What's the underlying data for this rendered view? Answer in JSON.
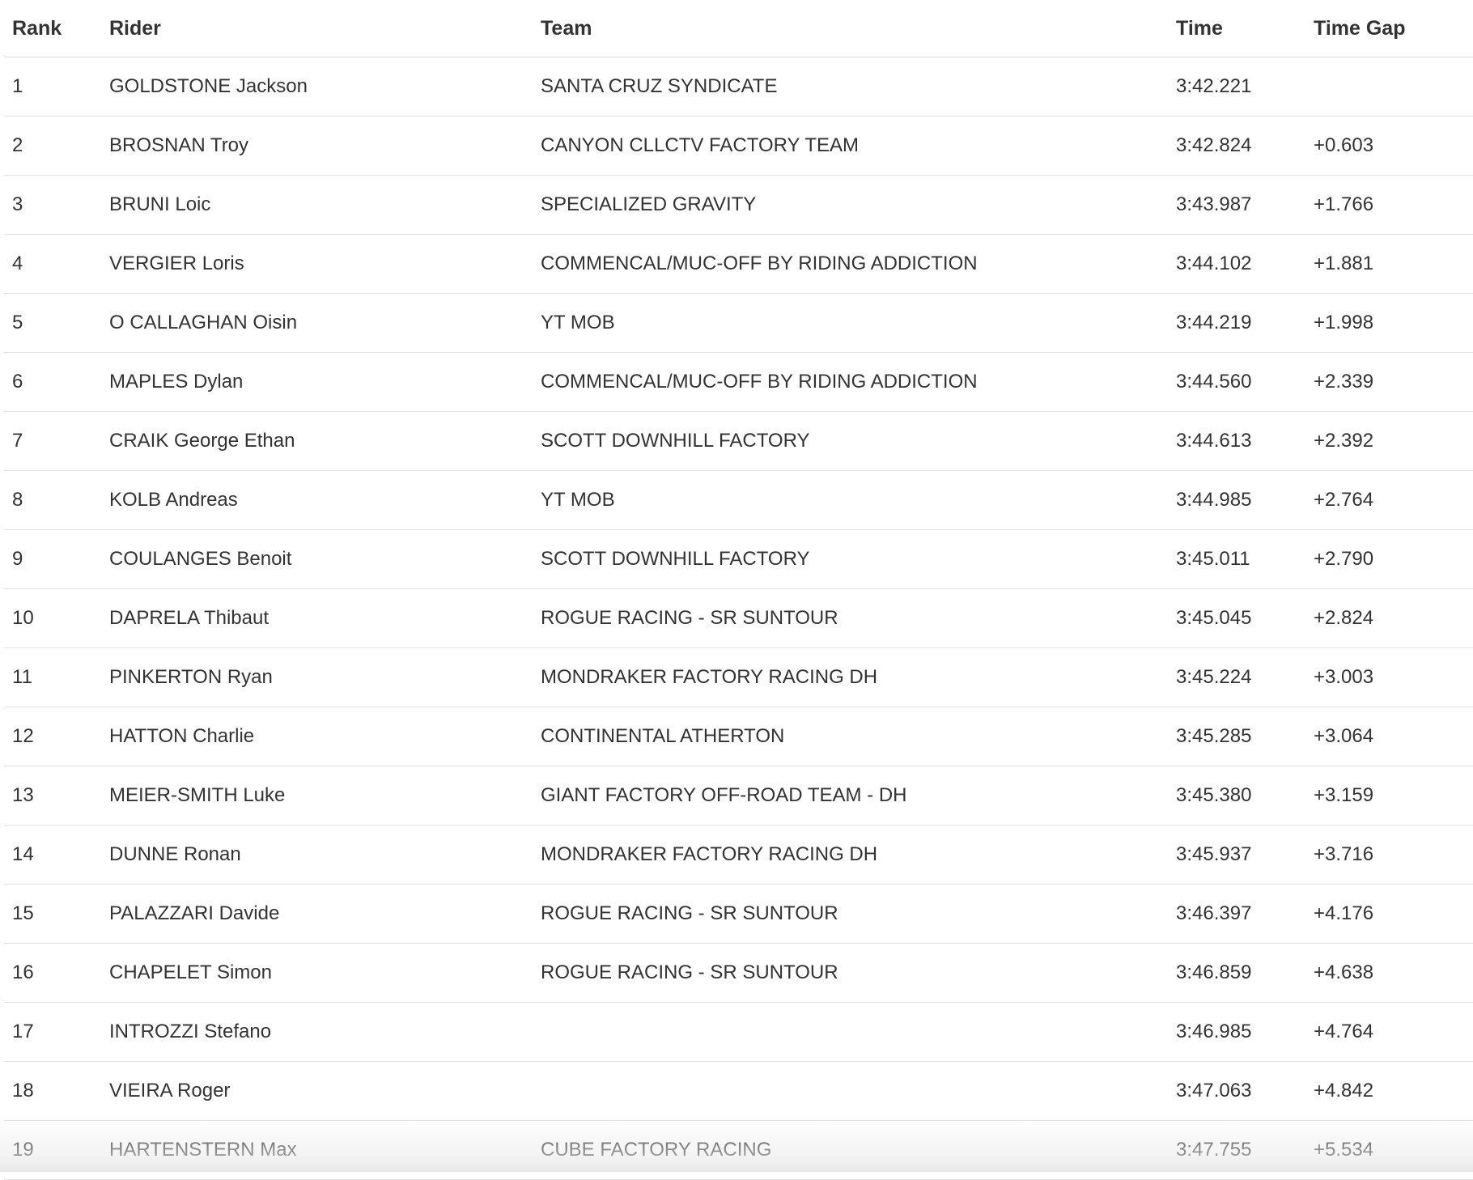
{
  "table": {
    "headers": {
      "rank": "Rank",
      "rider": "Rider",
      "team": "Team",
      "time": "Time",
      "gap": "Time Gap"
    },
    "rows": [
      {
        "rank": "1",
        "rider": "GOLDSTONE Jackson",
        "team": "SANTA CRUZ SYNDICATE",
        "time": "3:42.221",
        "gap": ""
      },
      {
        "rank": "2",
        "rider": "BROSNAN Troy",
        "team": "CANYON CLLCTV FACTORY TEAM",
        "time": "3:42.824",
        "gap": "+0.603"
      },
      {
        "rank": "3",
        "rider": "BRUNI Loic",
        "team": "SPECIALIZED GRAVITY",
        "time": "3:43.987",
        "gap": "+1.766"
      },
      {
        "rank": "4",
        "rider": "VERGIER Loris",
        "team": "COMMENCAL/MUC-OFF BY RIDING ADDICTION",
        "time": "3:44.102",
        "gap": "+1.881"
      },
      {
        "rank": "5",
        "rider": "O CALLAGHAN Oisin",
        "team": "YT MOB",
        "time": "3:44.219",
        "gap": "+1.998"
      },
      {
        "rank": "6",
        "rider": "MAPLES Dylan",
        "team": "COMMENCAL/MUC-OFF BY RIDING ADDICTION",
        "time": "3:44.560",
        "gap": "+2.339"
      },
      {
        "rank": "7",
        "rider": "CRAIK George Ethan",
        "team": "SCOTT DOWNHILL FACTORY",
        "time": "3:44.613",
        "gap": "+2.392"
      },
      {
        "rank": "8",
        "rider": "KOLB Andreas",
        "team": "YT MOB",
        "time": "3:44.985",
        "gap": "+2.764"
      },
      {
        "rank": "9",
        "rider": "COULANGES Benoit",
        "team": "SCOTT DOWNHILL FACTORY",
        "time": "3:45.011",
        "gap": "+2.790"
      },
      {
        "rank": "10",
        "rider": "DAPRELA Thibaut",
        "team": "ROGUE RACING - SR SUNTOUR",
        "time": "3:45.045",
        "gap": "+2.824"
      },
      {
        "rank": "11",
        "rider": "PINKERTON Ryan",
        "team": "MONDRAKER FACTORY RACING DH",
        "time": "3:45.224",
        "gap": "+3.003"
      },
      {
        "rank": "12",
        "rider": "HATTON Charlie",
        "team": "CONTINENTAL ATHERTON",
        "time": "3:45.285",
        "gap": "+3.064"
      },
      {
        "rank": "13",
        "rider": "MEIER-SMITH Luke",
        "team": "GIANT FACTORY OFF-ROAD TEAM - DH",
        "time": "3:45.380",
        "gap": "+3.159"
      },
      {
        "rank": "14",
        "rider": "DUNNE Ronan",
        "team": "MONDRAKER FACTORY RACING DH",
        "time": "3:45.937",
        "gap": "+3.716"
      },
      {
        "rank": "15",
        "rider": "PALAZZARI Davide",
        "team": "ROGUE RACING - SR SUNTOUR",
        "time": "3:46.397",
        "gap": "+4.176"
      },
      {
        "rank": "16",
        "rider": "CHAPELET Simon",
        "team": "ROGUE RACING - SR SUNTOUR",
        "time": "3:46.859",
        "gap": "+4.638"
      },
      {
        "rank": "17",
        "rider": "INTROZZI Stefano",
        "team": "",
        "time": "3:46.985",
        "gap": "+4.764"
      },
      {
        "rank": "18",
        "rider": "VIEIRA Roger",
        "team": "",
        "time": "3:47.063",
        "gap": "+4.842"
      },
      {
        "rank": "19",
        "rider": "HARTENSTERN Max",
        "team": "CUBE FACTORY RACING",
        "time": "3:47.755",
        "gap": "+5.534"
      }
    ]
  }
}
